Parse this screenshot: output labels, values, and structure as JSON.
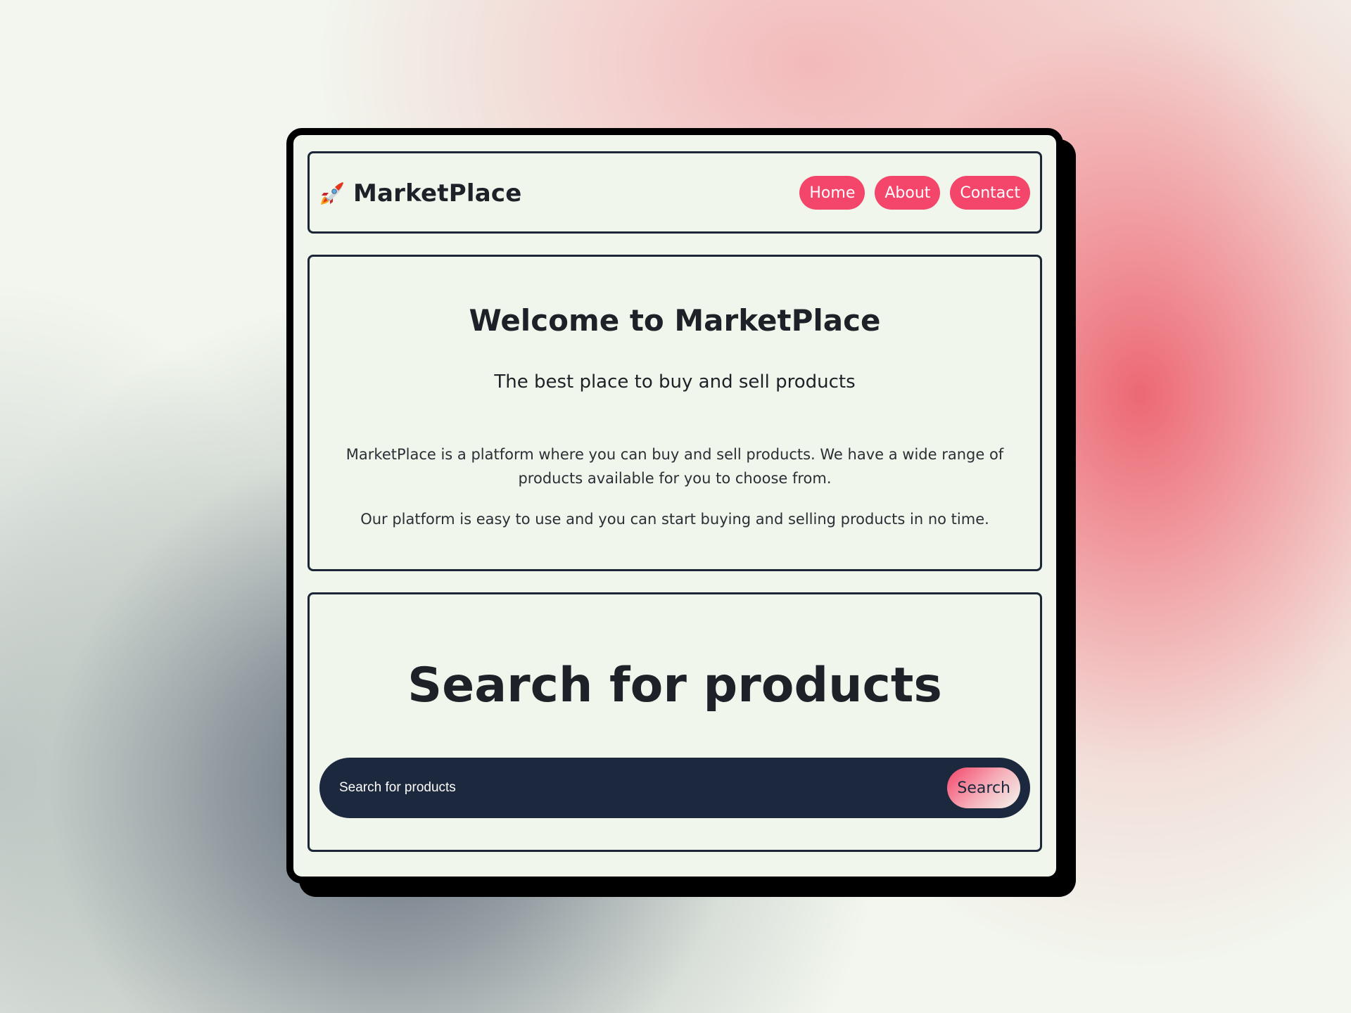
{
  "header": {
    "brand_icon": "rocket-icon",
    "brand_name": "MarketPlace",
    "nav": [
      {
        "label": "Home"
      },
      {
        "label": "About"
      },
      {
        "label": "Contact"
      }
    ]
  },
  "hero": {
    "title": "Welcome to MarketPlace",
    "subtitle": "The best place to buy and sell products",
    "paragraphs": [
      "MarketPlace is a platform where you can buy and sell products. We have a wide range of products available for you to choose from.",
      "Our platform is easy to use and you can start buying and selling products in no time."
    ]
  },
  "search": {
    "title": "Search for products",
    "placeholder": "Search for products",
    "button_label": "Search"
  },
  "colors": {
    "accent": "#f4456a",
    "dark": "#1c283d",
    "panel_bg": "#f1f6ec",
    "text": "#1e2228"
  }
}
